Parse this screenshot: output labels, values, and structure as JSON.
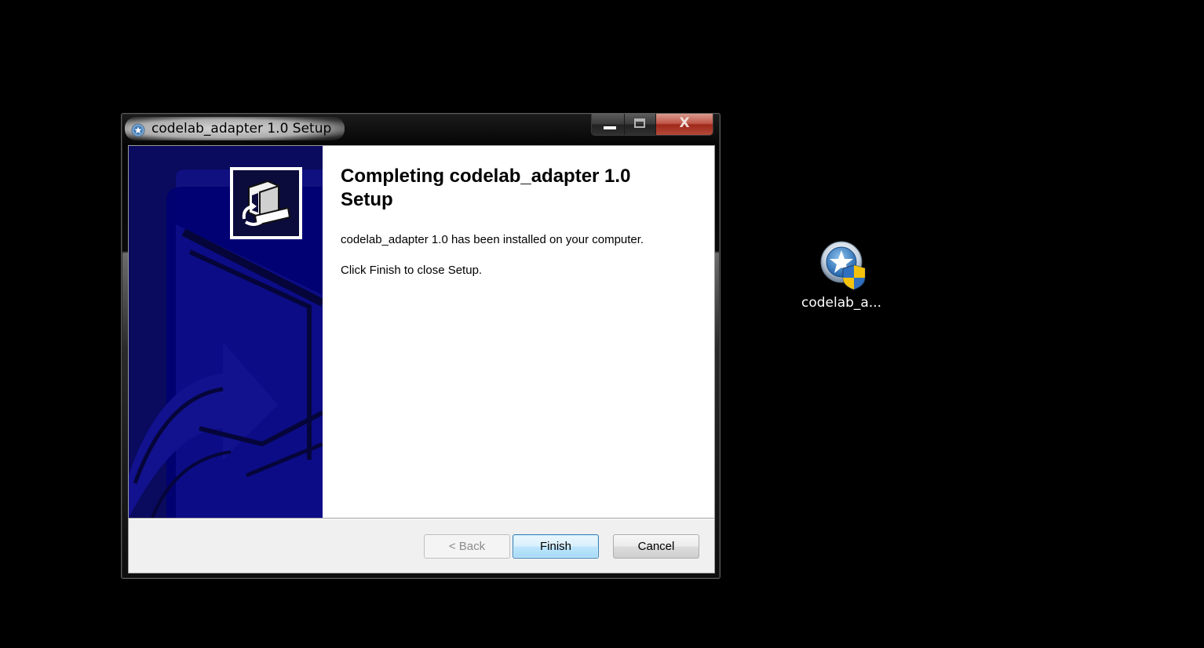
{
  "window": {
    "title": "codelab_adapter 1.0 Setup",
    "app_icon": "installer-star-icon",
    "caption": {
      "minimize_icon": "minimize-icon",
      "maximize_icon": "maximize-icon",
      "close_icon": "close-icon",
      "close_glyph": "X"
    }
  },
  "wizard": {
    "heading": "Completing codelab_adapter 1.0 Setup",
    "message": "codelab_adapter 1.0 has been installed on your computer.",
    "instruction": "Click Finish to close Setup.",
    "banner_icon": "installer-computer-icon"
  },
  "buttons": {
    "back": "< Back",
    "finish": "Finish",
    "cancel": "Cancel"
  },
  "desktop": {
    "icon_label": "codelab_a...",
    "icon_name": "installer-shield-icon"
  },
  "colors": {
    "banner": "#0a0a5e",
    "finish_border": "#3c7fb1",
    "close_red": "#c0584a"
  }
}
